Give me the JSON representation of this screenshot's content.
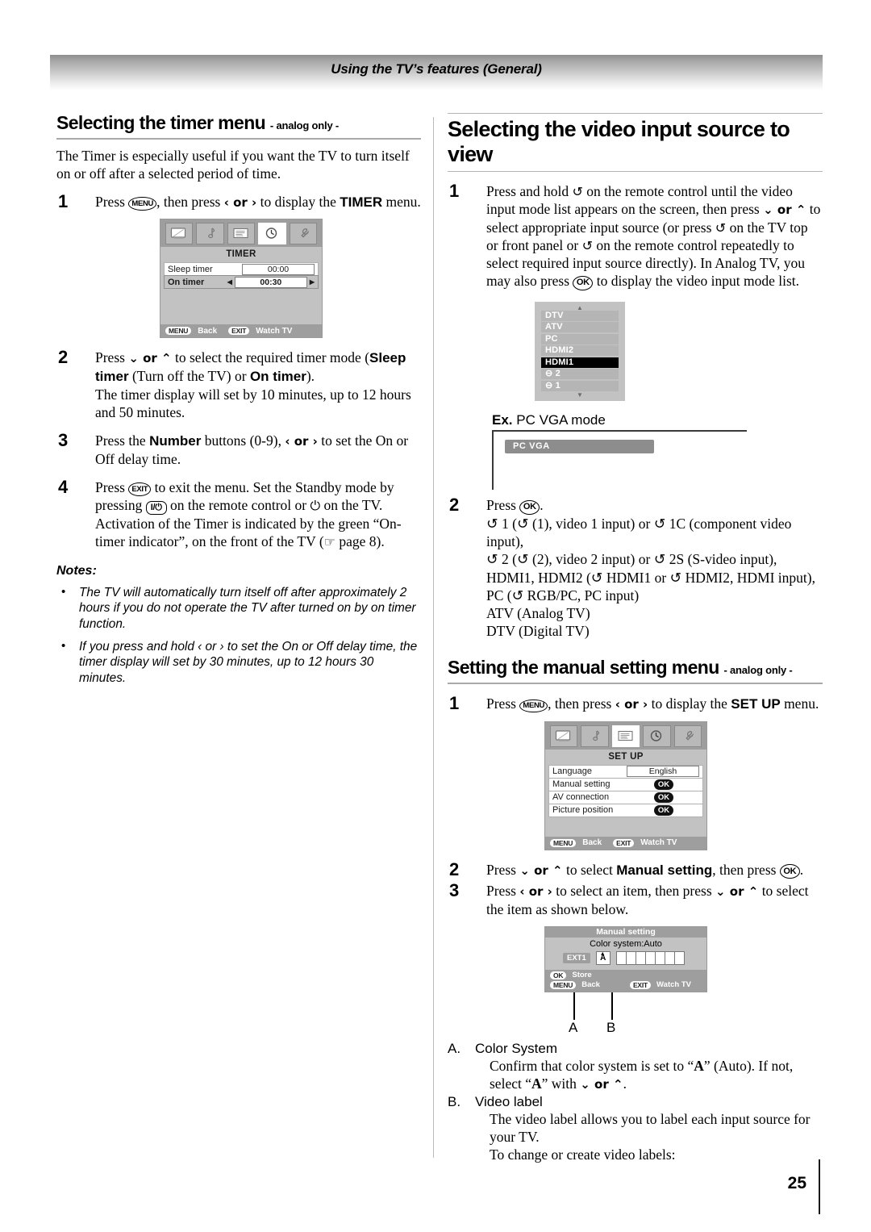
{
  "header": {
    "running_title": "Using the TV’s features (General)"
  },
  "page": {
    "number": "25"
  },
  "left": {
    "heading": {
      "main": "Selecting the timer menu",
      "suffix": "- analog only -"
    },
    "intro": "The Timer is especially useful if you want the TV to turn itself on or off after a selected period of time.",
    "steps": [
      {
        "num": "1",
        "text_a": "Press ",
        "key1": "MENU",
        "text_b": ", then press ",
        "arrows": "‹ or ›",
        "text_c": " to display the ",
        "bold": "TIMER",
        "text_d": " menu."
      },
      {
        "num": "2"
      },
      {
        "num": "3"
      },
      {
        "num": "4"
      }
    ],
    "step2": {
      "line1_a": "Press ",
      "arrows1": "⌄ or ⌃",
      "line1_b": " to select the required timer mode (",
      "bold1": "Sleep timer",
      "line1_c": " (Turn off the TV) or ",
      "bold2": "On timer",
      "line1_d": ").",
      "line2": "The timer display will set by 10 minutes, up to 12 hours and 50 minutes."
    },
    "step3": {
      "a": "Press the ",
      "bold": "Number",
      "b": " buttons (0-9), ",
      "arrows": "‹ or ›",
      "c": " to set the On or Off delay time."
    },
    "step4": {
      "a": "Press ",
      "key1": "EXIT",
      "b": " to exit the menu. Set the Standby mode by pressing ",
      "key2": "I/⏻",
      "c": " on the remote control or ",
      "power": "⏻",
      "d": " on the TV.",
      "e": "Activation of the Timer is indicated by the green “On-timer indicator”, on the front of the TV (",
      "hand": "☞",
      "f": " page 8)."
    },
    "notes_title": "Notes:",
    "notes": [
      "The TV will automatically turn itself off after approximately 2 hours if you do not operate the TV after turned on by on timer function.",
      "If you press and hold ‹ or › to set the On or Off delay time, the timer display will set by 30 minutes, up to 12 hours 30 minutes."
    ],
    "timer_osd": {
      "tabs": [
        "picture-icon",
        "sound-icon",
        "feature-icon",
        "timer-icon",
        "setup-icon"
      ],
      "active_tab_index": 3,
      "title": "TIMER",
      "rows": [
        {
          "label": "Sleep timer",
          "value": "00:00",
          "selected": false
        },
        {
          "label": "On timer",
          "value": "00:30",
          "selected": true
        }
      ],
      "footer": [
        {
          "key": "MENU",
          "label": "Back"
        },
        {
          "key": "EXIT",
          "label": "Watch TV"
        }
      ]
    }
  },
  "right": {
    "heading1": "Selecting the video input source to view",
    "step1": {
      "num": "1",
      "a": "Press and hold ",
      "inp": "↺",
      "b": " on the remote control until the video input mode list appears on the screen, then press ",
      "arrows": "⌄ or ⌃",
      "c": " to select appropriate input source (or press ",
      "d": " on the TV top or front panel or ",
      "e": " on the remote control repeatedly to select required input source directly). In Analog TV, you may also press ",
      "ok": "OK",
      "f": " to display the video input mode list."
    },
    "source_list": {
      "items": [
        {
          "label": "DTV",
          "selected": false
        },
        {
          "label": "ATV",
          "selected": false
        },
        {
          "label": "PC",
          "selected": false
        },
        {
          "label": "HDMI2",
          "selected": false
        },
        {
          "label": "HDMI1",
          "selected": true
        },
        {
          "label": "⊖ 2",
          "selected": false
        },
        {
          "label": "⊖ 1",
          "selected": false
        }
      ],
      "caret_up": "▲",
      "caret_down": "▼"
    },
    "example": {
      "prefix": "Ex.",
      "label": " PC VGA mode",
      "chip": "PC   VGA"
    },
    "step2": {
      "num": "2",
      "l0": "Press ",
      "ok": "OK",
      "l0b": ".",
      "lines": [
        "↺ 1 (↺ (1), video 1 input) or ↺ 1C (component video input),",
        "↺ 2 (↺ (2), video 2 input) or ↺ 2S (S-video input),",
        "HDMI1, HDMI2 (↺ HDMI1 or ↺ HDMI2, HDMI input),",
        "PC (↺ RGB/PC, PC input)",
        "ATV (Analog TV)",
        "DTV (Digital TV)"
      ]
    },
    "heading2": {
      "main": "Setting the manual setting menu",
      "suffix": "- analog only -"
    },
    "ms_step1": {
      "num": "1",
      "a": "Press ",
      "key": "MENU",
      "b": ", then press ",
      "arrows": "‹ or ›",
      "c": " to display the ",
      "bold": "SET UP",
      "d": " menu."
    },
    "setup_osd": {
      "tabs": [
        "picture-icon",
        "sound-icon",
        "feature-icon",
        "timer-icon",
        "setup-icon"
      ],
      "active_tab_index": 2,
      "title": "SET UP",
      "rows": [
        {
          "label": "Language",
          "value": "English",
          "type": "text"
        },
        {
          "label": "Manual setting",
          "value": "OK",
          "type": "ok"
        },
        {
          "label": "AV connection",
          "value": "OK",
          "type": "ok"
        },
        {
          "label": "Picture position",
          "value": "OK",
          "type": "ok"
        }
      ],
      "footer": [
        {
          "key": "MENU",
          "label": "Back"
        },
        {
          "key": "EXIT",
          "label": "Watch TV"
        }
      ]
    },
    "ms_step2": {
      "num": "2",
      "a": "Press ",
      "arrows": "⌄ or ⌃",
      "b": " to select ",
      "bold": "Manual setting",
      "c": ", then press ",
      "ok": "OK",
      "d": "."
    },
    "ms_step3": {
      "num": "3",
      "a": "Press ",
      "arrows1": "‹ or ›",
      "b": " to select an item, then press ",
      "arrows2": "⌄ or ⌃",
      "c": " to select the item as shown below."
    },
    "manual_osd": {
      "title": "Manual setting",
      "subtitle": "Color system:Auto",
      "ext_label": "EXT1",
      "color_value": "A",
      "label_boxes": 7,
      "footer": [
        {
          "key": "OK",
          "label": "Store"
        },
        {
          "key": "MENU",
          "label": "Back"
        },
        {
          "key": "EXIT",
          "label": "Watch TV"
        }
      ]
    },
    "callouts": {
      "a": "A",
      "b": "B"
    },
    "items": [
      {
        "letter": "A.",
        "title": "Color System",
        "body_a": "Confirm that color system is set to “",
        "bold": "A",
        "body_b": "” (Auto). If not, select “",
        "bold2": "A",
        "body_c": "” with ",
        "arrows": "⌄ or ⌃",
        "body_d": "."
      },
      {
        "letter": "B.",
        "title": "Video label",
        "body_a": "The video label allows you to label each input source for your TV.",
        "body_b": "To change or create video labels:"
      }
    ]
  }
}
